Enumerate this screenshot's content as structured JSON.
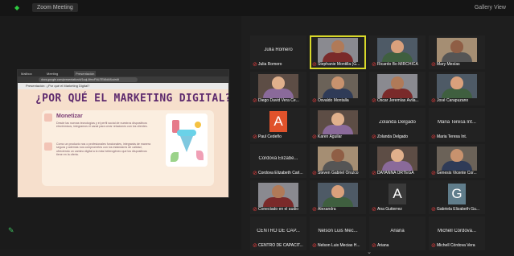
{
  "topbar": {
    "meeting_title": "Zoom Meeting",
    "view_label": "Gallery View"
  },
  "browser": {
    "tabs": [
      "Mailbox",
      "Meeting",
      "Presentación"
    ],
    "url": "docs.google.com/presentation/d/1uqL4fmcFNLl7Ek5dAfLs/edit",
    "slide_tab": "Presentación: ¿Por qué el Marketing Digital?"
  },
  "slide": {
    "title": "¿POR QUÉ EL MARKETING DIGITAL?",
    "heading": "Monetizar",
    "bullet1": "Desde las nuevas tecnologías y el perfil social de nuestros dispositivos electrónicos, integramos el canal para crear relaciones con los clientes.",
    "bullet2": "Como un producto nos o profesionales funcionales, integrarás de manera segura y además nos comprometes con los estándares de calidad, ofreciendo un camino digital a lo más heterogéneo que los dispositivos tiene en la oferta."
  },
  "gallery": {
    "tiles": [
      {
        "center": "Julia Romero",
        "name": "Julia Romero",
        "kind": "name",
        "avatar_color": ""
      },
      {
        "center": "",
        "name": "Stephanie Montilla (G...",
        "kind": "video",
        "avatar_color": "",
        "active": true
      },
      {
        "center": "",
        "name": "Ricardo Bo MIRCHICA",
        "kind": "video",
        "avatar_color": ""
      },
      {
        "center": "",
        "name": "Mary Mesías",
        "kind": "video",
        "avatar_color": ""
      },
      {
        "center": "",
        "name": "Diego David Vera Ce...",
        "kind": "video",
        "avatar_color": ""
      },
      {
        "center": "",
        "name": "Osvaldo Montalla",
        "kind": "video",
        "avatar_color": ""
      },
      {
        "center": "",
        "name": "Oscar Jeremías Ávila...",
        "kind": "video",
        "avatar_color": ""
      },
      {
        "center": "",
        "name": "José Carapuzano",
        "kind": "video",
        "avatar_color": ""
      },
      {
        "center": "",
        "name": "Paul Cedeño",
        "kind": "avatar",
        "avatar_letter": "A",
        "avatar_color": "#e0522b"
      },
      {
        "center": "",
        "name": "Karen Aguilar",
        "kind": "video",
        "avatar_color": ""
      },
      {
        "center": "Zolanda Delgado",
        "name": "Zolanda Delgado",
        "kind": "name",
        "avatar_color": ""
      },
      {
        "center": "Maria Teresa Int...",
        "name": "Maria Teresa Int.",
        "kind": "name",
        "avatar_color": ""
      },
      {
        "center": "Cordova Elizabe...",
        "name": "Cordova Elizabeth Carl...",
        "kind": "name",
        "avatar_color": ""
      },
      {
        "center": "",
        "name": "Steven Gabriel Orozco",
        "kind": "video",
        "avatar_color": ""
      },
      {
        "center": "",
        "name": "DAYANNA ORTEGA",
        "kind": "video",
        "avatar_color": ""
      },
      {
        "center": "",
        "name": "Genesis Vicente Cor...",
        "kind": "video",
        "avatar_color": ""
      },
      {
        "center": "",
        "name": "Conectado en el audio",
        "kind": "video",
        "avatar_color": ""
      },
      {
        "center": "",
        "name": "Alexandra",
        "kind": "video",
        "avatar_color": ""
      },
      {
        "center": "",
        "name": "Ana Gutierrez",
        "kind": "avatar",
        "avatar_letter": "A",
        "avatar_color": "#3a3a3a"
      },
      {
        "center": "",
        "name": "Gabriela Elizabeth Gu...",
        "kind": "avatar",
        "avatar_letter": "G",
        "avatar_color": "#607d8b"
      },
      {
        "center": "CENTRO DE CAP...",
        "name": "CENTRO DE CAPACIT...",
        "kind": "name",
        "avatar_color": ""
      },
      {
        "center": "Nelson Luis Mec...",
        "name": "Nelson Luis Mecias H...",
        "kind": "name",
        "avatar_color": ""
      },
      {
        "center": "Ariana",
        "name": "Ariana",
        "kind": "name",
        "avatar_color": ""
      },
      {
        "center": "Michell Córdova...",
        "name": "Michell Córdova Vera",
        "kind": "name",
        "avatar_color": ""
      }
    ]
  },
  "colors": {
    "slide_title": "#5e2a6e",
    "active_speaker_outline": "#d8d82a",
    "muted_mic": "#e23b3b"
  }
}
